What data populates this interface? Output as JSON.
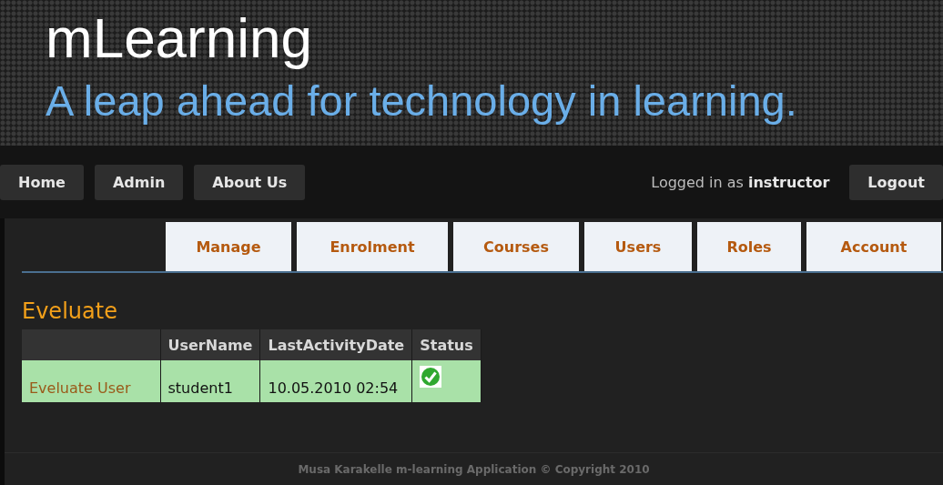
{
  "header": {
    "title": "mLearning",
    "tagline": "A leap ahead for technology in learning."
  },
  "nav": {
    "items": [
      {
        "label": "Home"
      },
      {
        "label": "Admin"
      },
      {
        "label": "About Us"
      }
    ],
    "login_prefix": "Logged in as",
    "login_user": "instructor",
    "logout": "Logout"
  },
  "subnav": [
    {
      "label": "Manage"
    },
    {
      "label": "Enrolment"
    },
    {
      "label": "Courses"
    },
    {
      "label": "Users"
    },
    {
      "label": "Roles"
    },
    {
      "label": "Account"
    }
  ],
  "section_title": "Eveluate",
  "table": {
    "columns": [
      "UserName",
      "LastActivityDate",
      "Status"
    ],
    "rows": [
      {
        "action": "Eveluate User",
        "user": "student1",
        "last_activity": "10.05.2010 02:54",
        "active": true
      }
    ]
  },
  "footer": "Musa Karakelle m-learning Application © Copyright 2010"
}
